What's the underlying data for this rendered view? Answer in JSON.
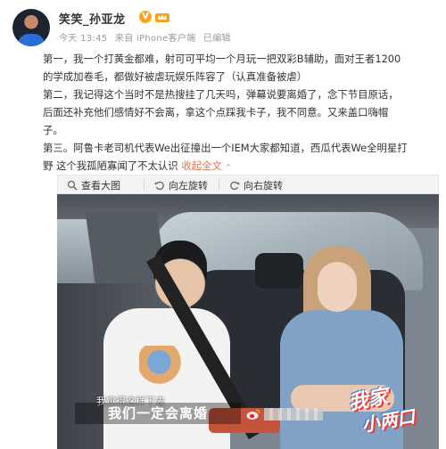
{
  "post": {
    "author": "笑笑_孙亚龙",
    "verified_badge": "V",
    "meta": {
      "time": "今天 13:45",
      "source": "来自 iPhone客户端",
      "edited": "已编辑"
    },
    "body_lines": [
      "第一，我一个打黄金都难，射可可平均一个月玩一把双彩B辅助，面对王者1200",
      "的学成加卷毛，都做好被虐玩娱乐阵容了（认真准备被虐）",
      "第二，我记得这个当时不是热搜挂了几天吗，弹幕说要离婚了，念下节目原话，",
      "后面还补充他们感情好不会离，拿这个点踩我卡子，我不同意。又来盖口嗨帽",
      "子。",
      "第三。阿鲁卡老司机代表We出征撞出一个IEM大家都知道，西瓜代表We全明星打",
      "野 这个我孤陋寡闻了不太认识"
    ],
    "expand_label": "收起全文",
    "expand_chevron": "^"
  },
  "image_toolbar": {
    "view_large": "查看大图",
    "rotate_left": "向左旋转",
    "rotate_right": "向右旋转"
  },
  "photo": {
    "caption_small": "我觉得这样下去",
    "caption_main": "我们一定会离婚",
    "show_logo_line1": "我家",
    "show_logo_line2": "小两口"
  },
  "colors": {
    "link": "#eb7350",
    "meta_text": "#999999",
    "body_text": "#333333",
    "toolbar_bg": "#f3f3f3"
  }
}
